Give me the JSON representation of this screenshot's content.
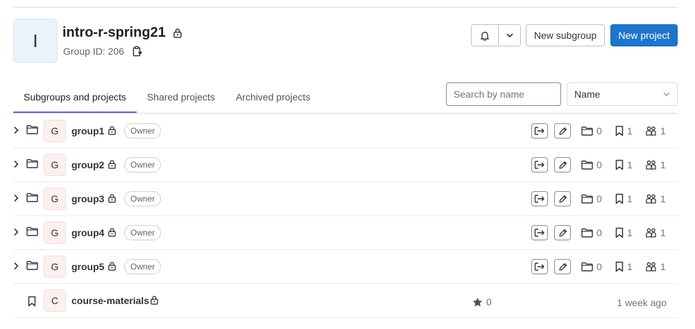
{
  "group": {
    "avatar_letter": "I",
    "name": "intro-r-spring21",
    "id_label": "Group ID: 206"
  },
  "header_buttons": {
    "new_subgroup": "New subgroup",
    "new_project": "New project"
  },
  "tabs": [
    {
      "label": "Subgroups and projects",
      "active": true
    },
    {
      "label": "Shared projects",
      "active": false
    },
    {
      "label": "Archived projects",
      "active": false
    }
  ],
  "search": {
    "placeholder": "Search by name",
    "value": ""
  },
  "sort": {
    "selected": "Name"
  },
  "subgroups": [
    {
      "letter": "G",
      "name": "group1",
      "role": "Owner",
      "subgroups": "0",
      "projects": "1",
      "members": "1"
    },
    {
      "letter": "G",
      "name": "group2",
      "role": "Owner",
      "subgroups": "0",
      "projects": "1",
      "members": "1"
    },
    {
      "letter": "G",
      "name": "group3",
      "role": "Owner",
      "subgroups": "0",
      "projects": "1",
      "members": "1"
    },
    {
      "letter": "G",
      "name": "group4",
      "role": "Owner",
      "subgroups": "0",
      "projects": "1",
      "members": "1"
    },
    {
      "letter": "G",
      "name": "group5",
      "role": "Owner",
      "subgroups": "0",
      "projects": "1",
      "members": "1"
    }
  ],
  "projects": [
    {
      "letter": "C",
      "name": "course-materials",
      "stars": "0",
      "updated": "1 week ago"
    }
  ],
  "colors": {
    "primary": "#1f75cb",
    "active_tab": "#6666c4",
    "group_avatar_bg": "#e9f3fc",
    "item_avatar_bg": "#fcf1ef"
  }
}
